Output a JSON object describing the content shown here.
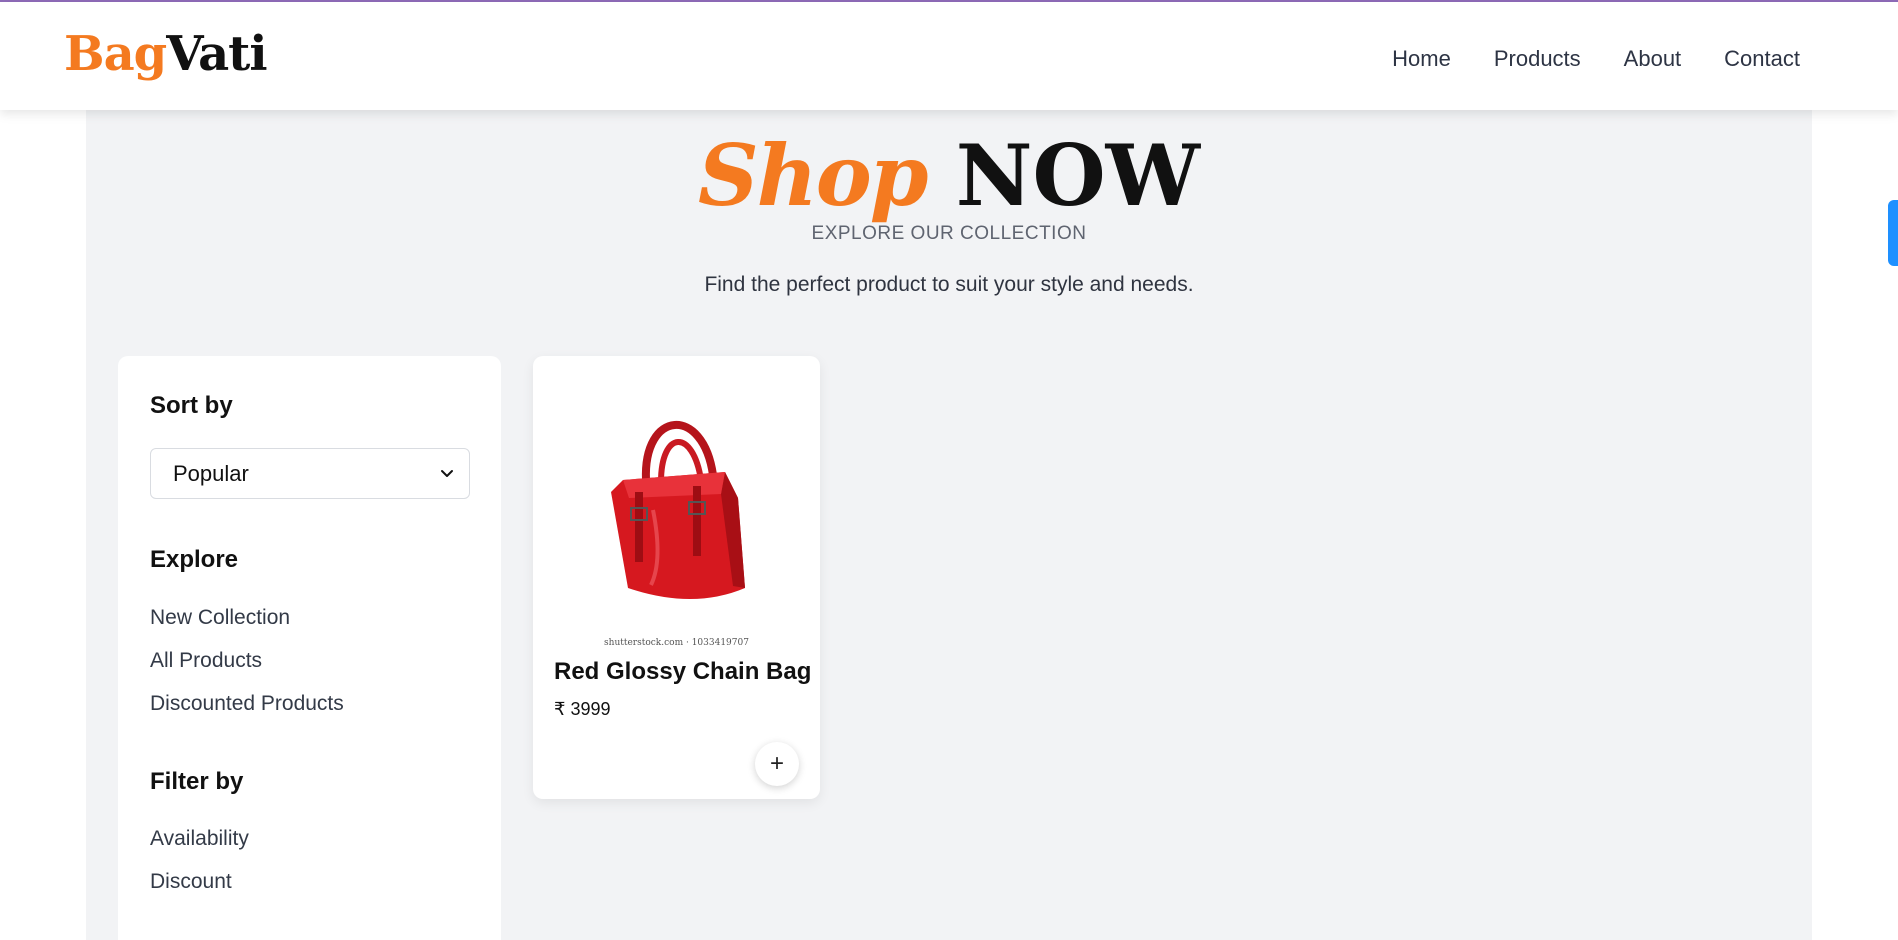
{
  "brand": {
    "part1": "Bag",
    "part2": "Vati"
  },
  "nav": {
    "links": [
      "Home",
      "Products",
      "About",
      "Contact"
    ]
  },
  "hero": {
    "title_shop": "Shop",
    "title_now": "NOW",
    "subtitle": "EXPLORE OUR COLLECTION",
    "description": "Find the perfect product to suit your style and needs."
  },
  "sidebar": {
    "sort_heading": "Sort by",
    "sort_selected": "Popular",
    "explore_heading": "Explore",
    "explore_links": [
      "New Collection",
      "All Products",
      "Discounted Products"
    ],
    "filter_heading": "Filter by",
    "filter_links": [
      "Availability",
      "Discount"
    ]
  },
  "products": [
    {
      "name": "Red Glossy Chain Bag",
      "price": "₹ 3999",
      "image_caption": "shutterstock.com · 1033419707",
      "add_label": "+"
    }
  ],
  "colors": {
    "accent": "#f47a20",
    "text_dark": "#111111",
    "bg": "#f2f3f5",
    "scroll": "#1e90ff"
  }
}
